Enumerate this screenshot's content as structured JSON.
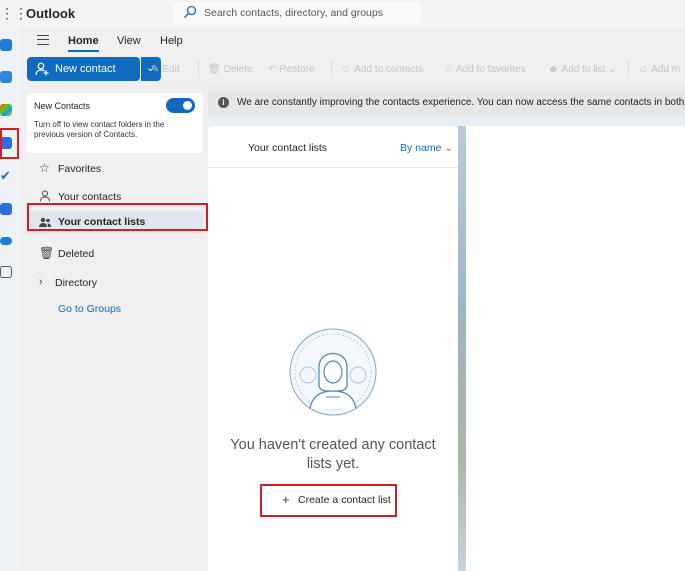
{
  "app": {
    "title": "Outlook"
  },
  "search": {
    "placeholder": "Search contacts, directory, and groups"
  },
  "ribbon": {
    "tabs": [
      {
        "label": "Home",
        "active": true
      },
      {
        "label": "View",
        "active": false
      },
      {
        "label": "Help",
        "active": false
      }
    ]
  },
  "toolbar": {
    "new_contact": "New contact",
    "edit": "Edit",
    "delete": "Delete",
    "restore": "Restore",
    "add_to_contacts": "Add to contacts",
    "add_to_favorites": "Add to favorites",
    "add_to_list": "Add to list",
    "add_more": "Add m"
  },
  "sidebar": {
    "new_contacts_title": "New Contacts",
    "new_contacts_desc": "Turn off to view contact folders in the previous version of Contacts.",
    "toggle_on": true,
    "items": [
      {
        "label": "Favorites",
        "icon": "star-icon"
      },
      {
        "label": "Your contacts",
        "icon": "person-icon"
      },
      {
        "label": "Your contact lists",
        "icon": "people-icon",
        "selected": true
      },
      {
        "label": "Deleted",
        "icon": "trash-icon"
      },
      {
        "label": "Directory",
        "icon": "chevron-right-icon"
      }
    ],
    "link": "Go to Groups"
  },
  "infobar": {
    "text": "We are constantly improving the contacts experience. You can now access the same contacts in both C"
  },
  "list_panel": {
    "title": "Your contact lists",
    "sort_label": "By name",
    "empty_message": "You haven't created any contact lists yet.",
    "create_label": "Create a contact list"
  },
  "colors": {
    "accent": "#0f6cbd",
    "highlight": "#d41b27"
  }
}
